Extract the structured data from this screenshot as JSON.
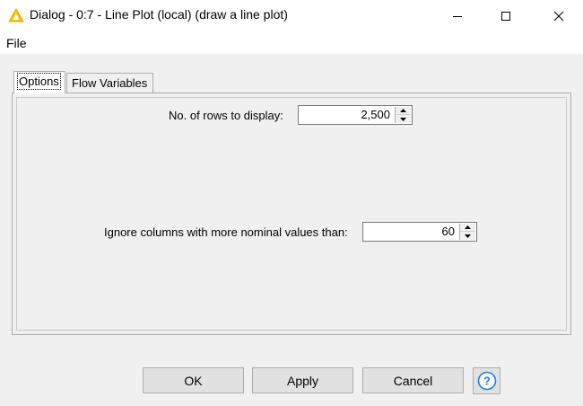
{
  "window": {
    "title": "Dialog - 0:7 - Line Plot (local) (draw a line plot)"
  },
  "menu": {
    "file": "File"
  },
  "tabs": [
    {
      "label": "Options"
    },
    {
      "label": "Flow Variables"
    }
  ],
  "options": {
    "rows_label": "No. of rows to display:",
    "rows_value": "2,500",
    "nominal_label": "Ignore columns with more nominal values than:",
    "nominal_value": "60"
  },
  "buttons": {
    "ok": "OK",
    "apply": "Apply",
    "cancel": "Cancel"
  }
}
